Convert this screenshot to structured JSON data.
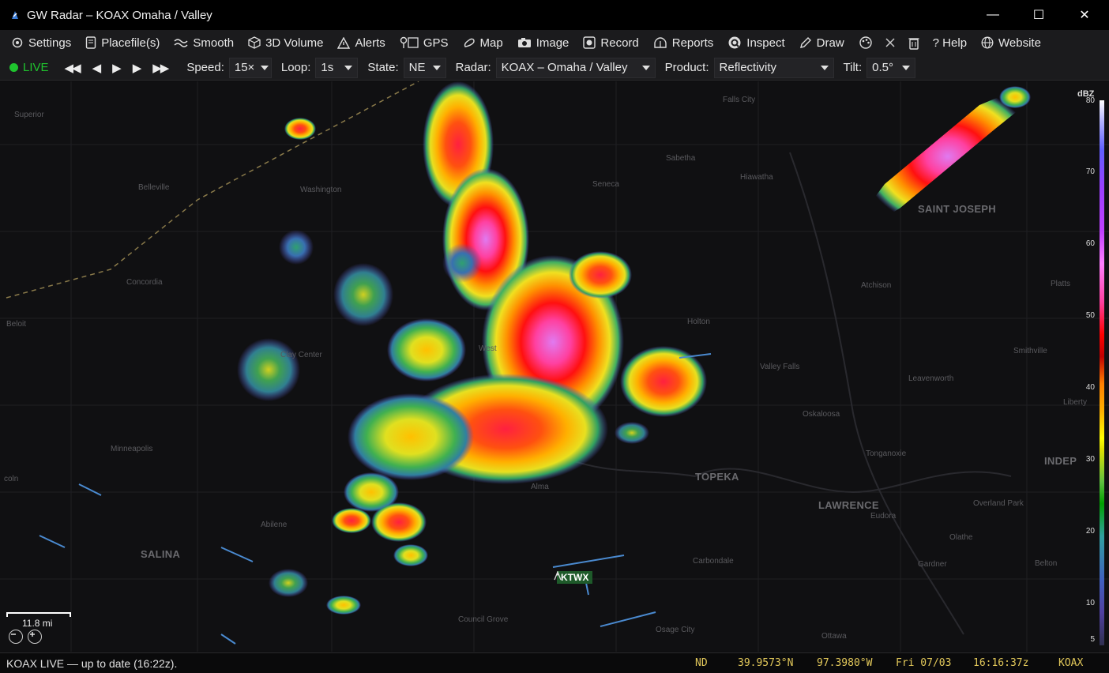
{
  "window": {
    "title": "GW Radar – KOAX  Omaha / Valley",
    "minimize": "—",
    "maximize": "☐",
    "close": "✕"
  },
  "menu": {
    "settings": "Settings",
    "placefiles": "Placefile(s)",
    "smooth": "Smooth",
    "volume3d": "3D Volume",
    "alerts": "Alerts",
    "gps": "GPS",
    "map": "Map",
    "image": "Image",
    "record": "Record",
    "reports": "Reports",
    "inspect": "Inspect",
    "draw": "Draw",
    "help": "? Help",
    "website": "Website"
  },
  "controls": {
    "live": "LIVE",
    "speed_label": "Speed:",
    "speed_value": "15×",
    "loop_label": "Loop:",
    "loop_value": "1s",
    "state_label": "State:",
    "state_value": "NE",
    "radar_label": "Radar:",
    "radar_value": "KOAX – Omaha / Valley",
    "product_label": "Product:",
    "product_value": "Reflectivity",
    "tilt_label": "Tilt:",
    "tilt_value": "0.5°"
  },
  "colorbar": {
    "unit": "dBZ",
    "ticks": [
      "80",
      "70",
      "60",
      "50",
      "40",
      "30",
      "20",
      "10",
      "5"
    ]
  },
  "map_labels": {
    "falls_city": "Falls City",
    "superior": "Superior",
    "belleville": "Belleville",
    "washington": "Washington",
    "sabetha": "Sabetha",
    "hiawatha": "Hiawatha",
    "seneca": "Seneca",
    "saint_joseph": "SAINT JOSEPH",
    "concordia": "Concordia",
    "beloit": "Beloit",
    "atchison": "Atchison",
    "plattsburg": "Platts",
    "holton": "Holton",
    "clay_center": "Clay Center",
    "westmoreland": "West",
    "valley_falls": "Valley Falls",
    "smithville": "Smithville",
    "leavenworth": "Leavenworth",
    "liberty": "Liberty",
    "oskaloosa": "Oskaloosa",
    "minneapolis": "Minneapolis",
    "tonganoxie": "Tonganoxie",
    "independence": "INDEP",
    "lincoln": "coln",
    "topeka": "TOPEKA",
    "alma": "Alma",
    "lawrence": "LAWRENCE",
    "eudora": "Eudora",
    "overland_park": "Overland Park",
    "abilene": "Abilene",
    "olathe": "Olathe",
    "salina": "SALINA",
    "carbondale": "Carbondale",
    "gardner": "Gardner",
    "belton": "Belton",
    "council_grove": "Council Grove",
    "osage_city": "Osage City",
    "ottawa": "Ottawa"
  },
  "site": {
    "label": "KTWX"
  },
  "scale": {
    "label": "11.8 mi"
  },
  "status": {
    "text": "KOAX LIVE — up to date (16:22z).",
    "state": "ND",
    "lat": "39.9573°N",
    "lon": "97.3980°W",
    "date": "Fri 07/03",
    "time": "16:16:37z",
    "radar": "KOAX"
  }
}
